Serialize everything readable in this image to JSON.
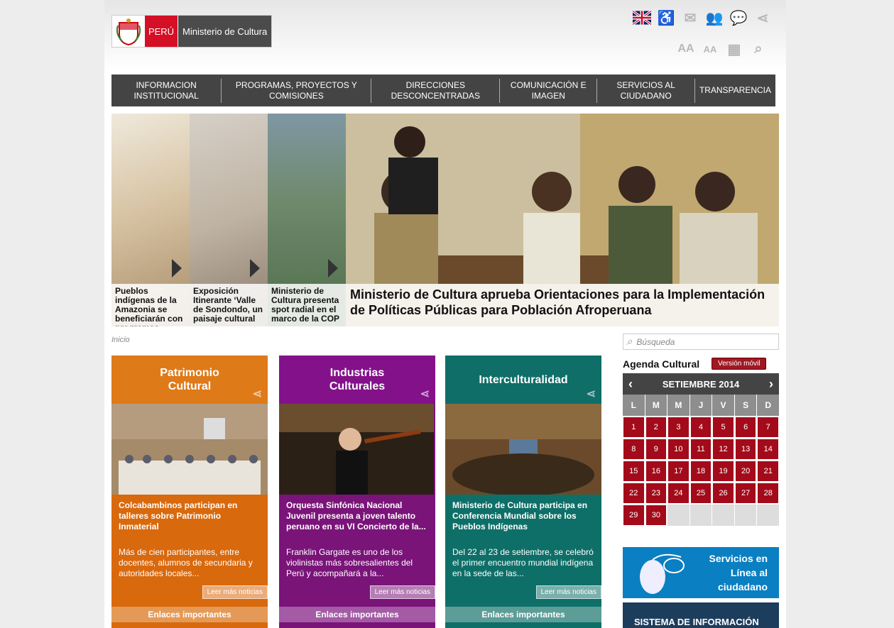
{
  "header": {
    "peru": "PERÚ",
    "ministerio": "Ministerio de Cultura"
  },
  "nav": [
    "INFORMACION INSTITUCIONAL",
    "PROGRAMAS, PROYECTOS Y COMISIONES",
    "DIRECCIONES DESCONCENTRADAS",
    "COMUNICACIÓN E IMAGEN",
    "SERVICIOS AL CIUDADANO",
    "TRANSPARENCIA"
  ],
  "slider": {
    "thumbs": [
      "Pueblos indígenas de la Amazonia se beneficiarán con programas",
      "Exposición Itinerante ‘Valle de Sondondo, un paisaje cultural",
      "Ministerio de Cultura presenta spot radial en el marco de la COP"
    ],
    "main": "Ministerio de Cultura aprueba Orientaciones para la Implementación de Políticas Públicas para Población Afroperuana"
  },
  "breadcrumb": "Inicio",
  "cards": [
    {
      "head": "Patrimonio Cultural",
      "title": "Colcabambinos participan en talleres sobre Patrimonio Inmaterial",
      "desc": "Más de cien participantes, entre docentes, alumnos de secundaria y autoridades locales...",
      "more": "Leer más noticias",
      "links": "Enlaces importantes"
    },
    {
      "head": "Industrias Culturales",
      "title": "Orquesta Sinfónica Nacional Juvenil presenta a joven talento peruano en su VI Concierto de la...",
      "desc": "Franklin Gargate es uno de los violinistas más sobresalientes del Perú y acompañará a la...",
      "more": "Leer más noticias",
      "links": "Enlaces importantes"
    },
    {
      "head": "Interculturalidad",
      "title": "Ministerio de Cultura participa en Conferencia Mundial sobre los Pueblos Indígenas",
      "desc": "Del 22 al 23 de setiembre, se celebró el primer encuentro mundial indígena en la sede de las...",
      "more": "Leer más noticias",
      "links": "Enlaces importantes"
    }
  ],
  "search": {
    "placeholder": "Búsqueda"
  },
  "agenda": {
    "title": "Agenda Cultural",
    "movil": "Versión móvil",
    "month": "SETIEMBRE 2014",
    "days": [
      "L",
      "M",
      "M",
      "J",
      "V",
      "S",
      "D"
    ]
  },
  "banners": {
    "servicios": "Servicios en Línea al ciudadano",
    "sistema": "SISTEMA DE INFORMACIÓN"
  }
}
